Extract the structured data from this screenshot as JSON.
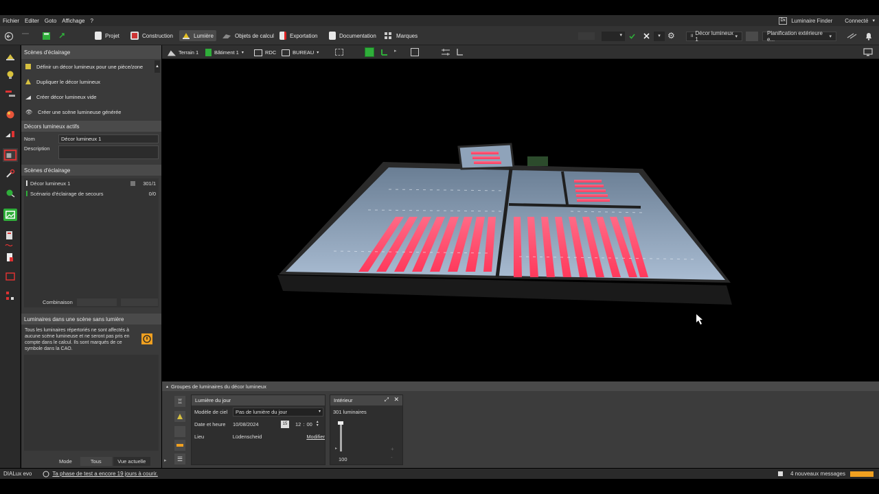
{
  "menu": {
    "items": [
      "Fichier",
      "Editer",
      "Goto",
      "Affichage",
      "?"
    ],
    "luminaire_finder_badge": "Dx",
    "luminaire_finder": "Luminaire Finder",
    "connect": "Connecté"
  },
  "toolbar": {
    "tabs": [
      {
        "label": "Projet",
        "icon": "document-icon"
      },
      {
        "label": "Construction",
        "icon": "construction-icon"
      },
      {
        "label": "Lumière",
        "icon": "lamp-icon",
        "active": true
      },
      {
        "label": "Objets de calcul",
        "icon": "calc-objects-icon"
      },
      {
        "label": "Exportation",
        "icon": "export-icon"
      },
      {
        "label": "Documentation",
        "icon": "documentation-icon"
      },
      {
        "label": "Marques",
        "icon": "marks-icon"
      }
    ],
    "scene_select": "Décor lumineux 1",
    "planning_select": "Planification extérieure e...",
    "scene_select_marker": "II"
  },
  "viewbar": {
    "terrain": "Terrain 1",
    "batiment": "Bâtiment 1",
    "level": "RDC",
    "room": "BUREAU"
  },
  "panel": {
    "scenes_header": "Scènes d'éclairage",
    "actions": [
      "Définir un décor lumineux pour une pièce/zone",
      "Dupliquer le décor lumineux",
      "Créer décor lumineux vide",
      "Créer une scène lumineuse générée"
    ],
    "active_header": "Décors lumineux actifs",
    "name_label": "Nom",
    "name_value": "Décor lumineux 1",
    "desc_label": "Description",
    "desc_value": "",
    "scenes_list_header": "Scènes d'éclairage",
    "scenes": [
      {
        "label": "Décor lumineux 1",
        "count": "301/1"
      },
      {
        "label": "Scénario d'éclairage de secours",
        "count": "0/0"
      }
    ],
    "combination_label": "Combinaison",
    "unassigned_header": "Luminaires dans une scène sans lumière",
    "unassigned_text": "Tous les luminaires répertoriés ne sont affectés à aucune scène lumineuse et ne seront pas pris en compte dans le calcul. Ils sont marqués de ce symbole dans la CAO.",
    "mode_label": "Mode",
    "mode_all": "Tous",
    "mode_current": "Vue actuelle"
  },
  "bottom": {
    "header": "Groupes de luminaires du décor lumineux",
    "daylight": {
      "title": "Lumière du jour",
      "sky_label": "Modèle de ciel",
      "sky_value": "Pas de lumière du jour",
      "date_label": "Date et heure",
      "date_value": "10/08/2024",
      "calendar_day": "15",
      "hour": "12",
      "time_sep": ":",
      "minute": "00",
      "place_label": "Lieu",
      "place_value": "Lüdenscheid",
      "modify": "Modifier"
    },
    "interior": {
      "title": "Intérieur",
      "count": "301 luminaires",
      "dim_value": "100",
      "dim_level": 1.0
    }
  },
  "status": {
    "brand": "DIALux evo",
    "trial": "Ta phase de test a encore 19 jours à courir.",
    "messages": "4 nouveaux messages"
  },
  "colors": {
    "accent": "#f0a020",
    "luminaire_red": "#ff4a6a",
    "floor_blue": "#9fb4cc",
    "active_green": "#2fae3a"
  }
}
